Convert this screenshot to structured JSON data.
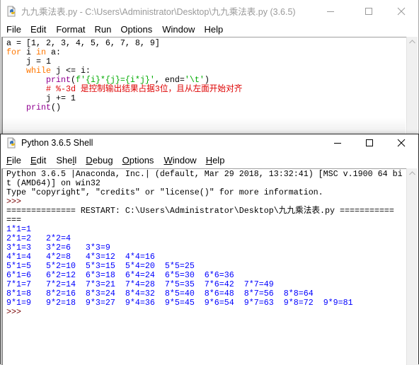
{
  "editor": {
    "title": "九九乘法表.py - C:\\Users\\Administrator\\Desktop\\九九乘法表.py (3.6.5)",
    "icon": "python-file-icon",
    "state": "inactive",
    "menu": [
      {
        "label": "File"
      },
      {
        "label": "Edit"
      },
      {
        "label": "Format"
      },
      {
        "label": "Run"
      },
      {
        "label": "Options"
      },
      {
        "label": "Window"
      },
      {
        "label": "Help"
      }
    ],
    "code_lines": [
      [
        {
          "t": "a = [1, 2, 3, 4, 5, 6, 7, 8, 9]",
          "c": "default"
        }
      ],
      [
        {
          "t": "for",
          "c": "keyword"
        },
        {
          "t": " i ",
          "c": "default"
        },
        {
          "t": "in",
          "c": "keyword"
        },
        {
          "t": " a:",
          "c": "default"
        }
      ],
      [
        {
          "t": "    j = 1",
          "c": "default"
        }
      ],
      [
        {
          "t": "    ",
          "c": "default"
        },
        {
          "t": "while",
          "c": "keyword"
        },
        {
          "t": " j <= i:",
          "c": "default"
        }
      ],
      [
        {
          "t": "        ",
          "c": "default"
        },
        {
          "t": "print",
          "c": "builtin"
        },
        {
          "t": "(",
          "c": "default"
        },
        {
          "t": "f'{i}*{j}={i*j}'",
          "c": "string"
        },
        {
          "t": ", end=",
          "c": "default"
        },
        {
          "t": "'\\t'",
          "c": "string"
        },
        {
          "t": ")",
          "c": "default"
        }
      ],
      [
        {
          "t": "        ",
          "c": "default"
        },
        {
          "t": "# %-3d 是控制输出结果占据3位，且从左面开始对齐",
          "c": "comment"
        }
      ],
      [
        {
          "t": "        j += 1",
          "c": "default"
        }
      ],
      [
        {
          "t": "    ",
          "c": "default"
        },
        {
          "t": "print",
          "c": "builtin"
        },
        {
          "t": "()",
          "c": "default"
        }
      ]
    ]
  },
  "shell": {
    "title": "Python 3.6.5 Shell",
    "icon": "python-file-icon",
    "state": "active",
    "menu": [
      {
        "label": "File",
        "underline": 0
      },
      {
        "label": "Edit",
        "underline": 0
      },
      {
        "label": "Shell",
        "underline": 3
      },
      {
        "label": "Debug",
        "underline": 0
      },
      {
        "label": "Options",
        "underline": 0
      },
      {
        "label": "Window",
        "underline": 0
      },
      {
        "label": "Help",
        "underline": 0
      }
    ],
    "lines": [
      [
        {
          "t": "Python 3.6.5 |Anaconda, Inc.| (default, Mar 29 2018, 13:32:41) [MSC v.1900 64 bi",
          "c": "default"
        }
      ],
      [
        {
          "t": "t (AMD64)] on win32",
          "c": "default"
        }
      ],
      [
        {
          "t": "Type \"copyright\", \"credits\" or \"license()\" for more information.",
          "c": "default"
        }
      ],
      [
        {
          "t": ">>> ",
          "c": "prompt"
        }
      ],
      [
        {
          "t": "============== RESTART: C:\\Users\\Administrator\\Desktop\\九九乘法表.py ===========",
          "c": "default"
        }
      ],
      [
        {
          "t": "===",
          "c": "default"
        }
      ],
      [
        {
          "t": "1*1=1\t",
          "c": "stdout"
        }
      ],
      [
        {
          "t": "2*1=2\t2*2=4\t",
          "c": "stdout"
        }
      ],
      [
        {
          "t": "3*1=3\t3*2=6\t3*3=9\t",
          "c": "stdout"
        }
      ],
      [
        {
          "t": "4*1=4\t4*2=8\t4*3=12\t4*4=16\t",
          "c": "stdout"
        }
      ],
      [
        {
          "t": "5*1=5\t5*2=10\t5*3=15\t5*4=20\t5*5=25\t",
          "c": "stdout"
        }
      ],
      [
        {
          "t": "6*1=6\t6*2=12\t6*3=18\t6*4=24\t6*5=30\t6*6=36\t",
          "c": "stdout"
        }
      ],
      [
        {
          "t": "7*1=7\t7*2=14\t7*3=21\t7*4=28\t7*5=35\t7*6=42\t7*7=49\t",
          "c": "stdout"
        }
      ],
      [
        {
          "t": "8*1=8\t8*2=16\t8*3=24\t8*4=32\t8*5=40\t8*6=48\t8*7=56\t8*8=64\t",
          "c": "stdout"
        }
      ],
      [
        {
          "t": "9*1=9\t9*2=18\t9*3=27\t9*4=36\t9*5=45\t9*6=54\t9*7=63\t9*8=72\t9*9=81\t",
          "c": "stdout"
        }
      ],
      [
        {
          "t": ">>> ",
          "c": "prompt"
        }
      ]
    ]
  },
  "window_controls": [
    "minimize-icon",
    "maximize-icon",
    "close-icon"
  ],
  "colors": {
    "keyword": "#ff7700",
    "builtin": "#900090",
    "string": "#00aa00",
    "comment": "#dd0000",
    "stdout": "#0000ff",
    "prompt": "#770000",
    "inactive_title": "#9a9a9a"
  }
}
